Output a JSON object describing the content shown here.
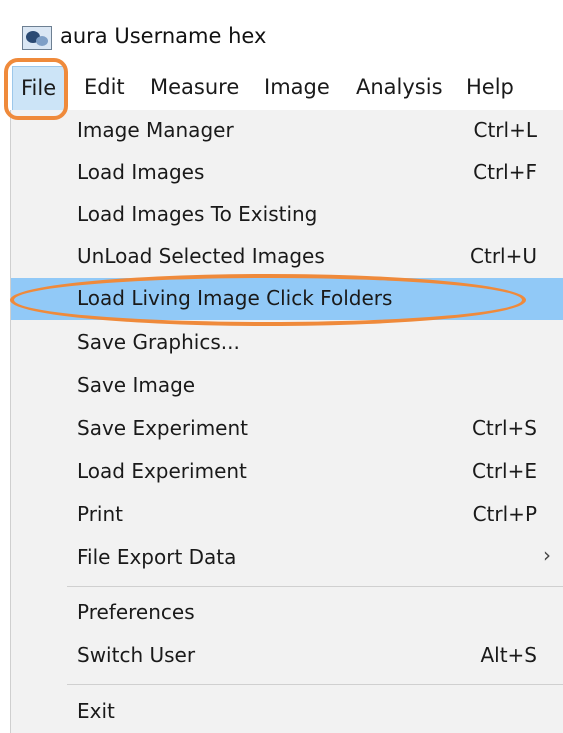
{
  "app": {
    "icon": "app-image-icon",
    "title": "aura   Username hex"
  },
  "menubar": {
    "items": [
      {
        "label": "File"
      },
      {
        "label": "Edit"
      },
      {
        "label": "Measure"
      },
      {
        "label": "Image"
      },
      {
        "label": "Analysis"
      },
      {
        "label": "Help"
      }
    ]
  },
  "file_menu": {
    "items": [
      {
        "label": "Image Manager",
        "shortcut": "Ctrl+L"
      },
      {
        "label": "Load Images",
        "shortcut": "Ctrl+F"
      },
      {
        "label": "Load Images To Existing",
        "shortcut": ""
      },
      {
        "label": "UnLoad Selected Images",
        "shortcut": "Ctrl+U"
      },
      {
        "label": "Load Living Image Click Folders",
        "shortcut": ""
      },
      {
        "label": "Save Graphics...",
        "shortcut": ""
      },
      {
        "label": "Save Image",
        "shortcut": ""
      },
      {
        "label": "Save Experiment",
        "shortcut": "Ctrl+S"
      },
      {
        "label": "Load Experiment",
        "shortcut": "Ctrl+E"
      },
      {
        "label": "Print",
        "shortcut": "Ctrl+P"
      },
      {
        "label": "File Export Data",
        "shortcut": "",
        "submenu_icon": "chevron-right-icon",
        "submenu_glyph": "›"
      },
      {
        "label": "Preferences",
        "shortcut": ""
      },
      {
        "label": "Switch User",
        "shortcut": "Alt+S"
      },
      {
        "label": "Exit",
        "shortcut": ""
      }
    ]
  },
  "colors": {
    "highlight": "#91c9f7",
    "callout": "#ef8a3b",
    "menu_background": "#f2f2f2"
  }
}
